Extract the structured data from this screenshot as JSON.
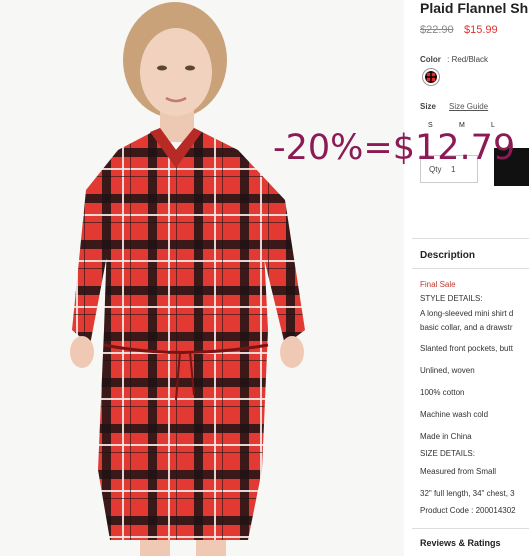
{
  "product": {
    "title": "Plaid Flannel Sh",
    "old_price": "$22.90",
    "new_price": "$15.99",
    "color_label": "Color",
    "color_value": ": Red/Black",
    "size_label": "Size",
    "size_guide": "Size Guide",
    "sizes": [
      "S",
      "M",
      "L"
    ],
    "qty_label": "Qty",
    "qty_value": "1"
  },
  "description": {
    "heading": "Description",
    "final_sale": "Final Sale",
    "style_details_label": "STYLE DETAILS:",
    "style_line1": "A long-sleeved mini shirt d",
    "style_line2": "basic collar, and a drawstr",
    "pockets": "Slanted front pockets, butt",
    "lining": "Unlined, woven",
    "material": "100% cotton",
    "care": "Machine wash cold",
    "origin": "Made in China",
    "size_details_label": "SIZE DETAILS:",
    "measured": "Measured from Small",
    "length": "32\" full length, 34\" chest, 3",
    "product_code": "Product Code : 200014302"
  },
  "reviews": {
    "heading": "Reviews & Ratings"
  },
  "overlay_text": "-20%=$12.79",
  "colors": {
    "accent_red": "#d33333",
    "overlay": "#8b1a55",
    "dress_red": "#d9302c"
  }
}
